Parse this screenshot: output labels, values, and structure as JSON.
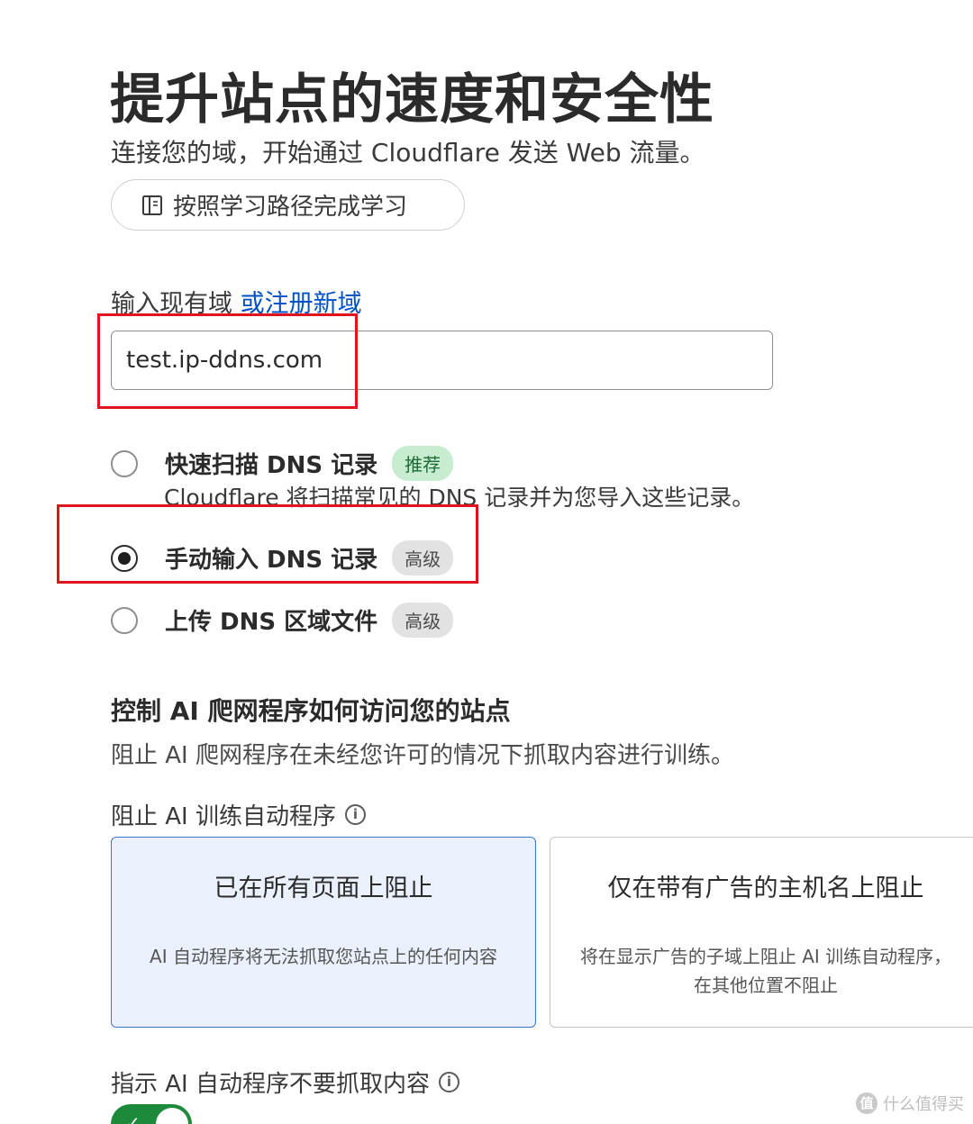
{
  "header": {
    "title": "提升站点的速度和安全性",
    "subtitle": "连接您的域，开始通过 Cloudflare 发送 Web 流量。",
    "learn_button_label": "按照学习路径完成学习"
  },
  "domain": {
    "label": "输入现有域",
    "register_link": "或注册新域",
    "input_value": "test.ip-ddns.com"
  },
  "dns_options": [
    {
      "label": "快速扫描 DNS 记录",
      "badge": "推荐",
      "badge_color": "green",
      "description": "Cloudflare 将扫描常见的 DNS 记录并为您导入这些记录。",
      "checked": false
    },
    {
      "label": "手动输入 DNS 记录",
      "badge": "高级",
      "badge_color": "gray",
      "checked": true
    },
    {
      "label": "上传 DNS 区域文件",
      "badge": "高级",
      "badge_color": "gray",
      "checked": false
    }
  ],
  "ai_section": {
    "title": "控制 AI 爬网程序如何访问您的站点",
    "description": "阻止 AI 爬网程序在未经您许可的情况下抓取内容进行训练。",
    "block_label": "阻止 AI 训练自动程序",
    "info_symbol": "i",
    "cards": [
      {
        "title": "已在所有页面上阻止",
        "description": "AI 自动程序将无法抓取您站点上的任何内容",
        "selected": true
      },
      {
        "title": "仅在带有广告的主机名上阻止",
        "description": "将在显示广告的子域上阻止 AI 训练自动程序，在其他位置不阻止",
        "selected": false
      }
    ],
    "instruct_label": "指示 AI 自动程序不要抓取内容",
    "toggle_on": true,
    "toggle_check": "✓"
  },
  "watermark": {
    "badge": "值",
    "text": "什么值得买"
  },
  "colors": {
    "link": "#0051c3",
    "highlight": "#e0141c",
    "toggle_on": "#1c8a3a",
    "selected_card_border": "#3b75d1",
    "selected_card_bg": "#eaf1fc"
  }
}
